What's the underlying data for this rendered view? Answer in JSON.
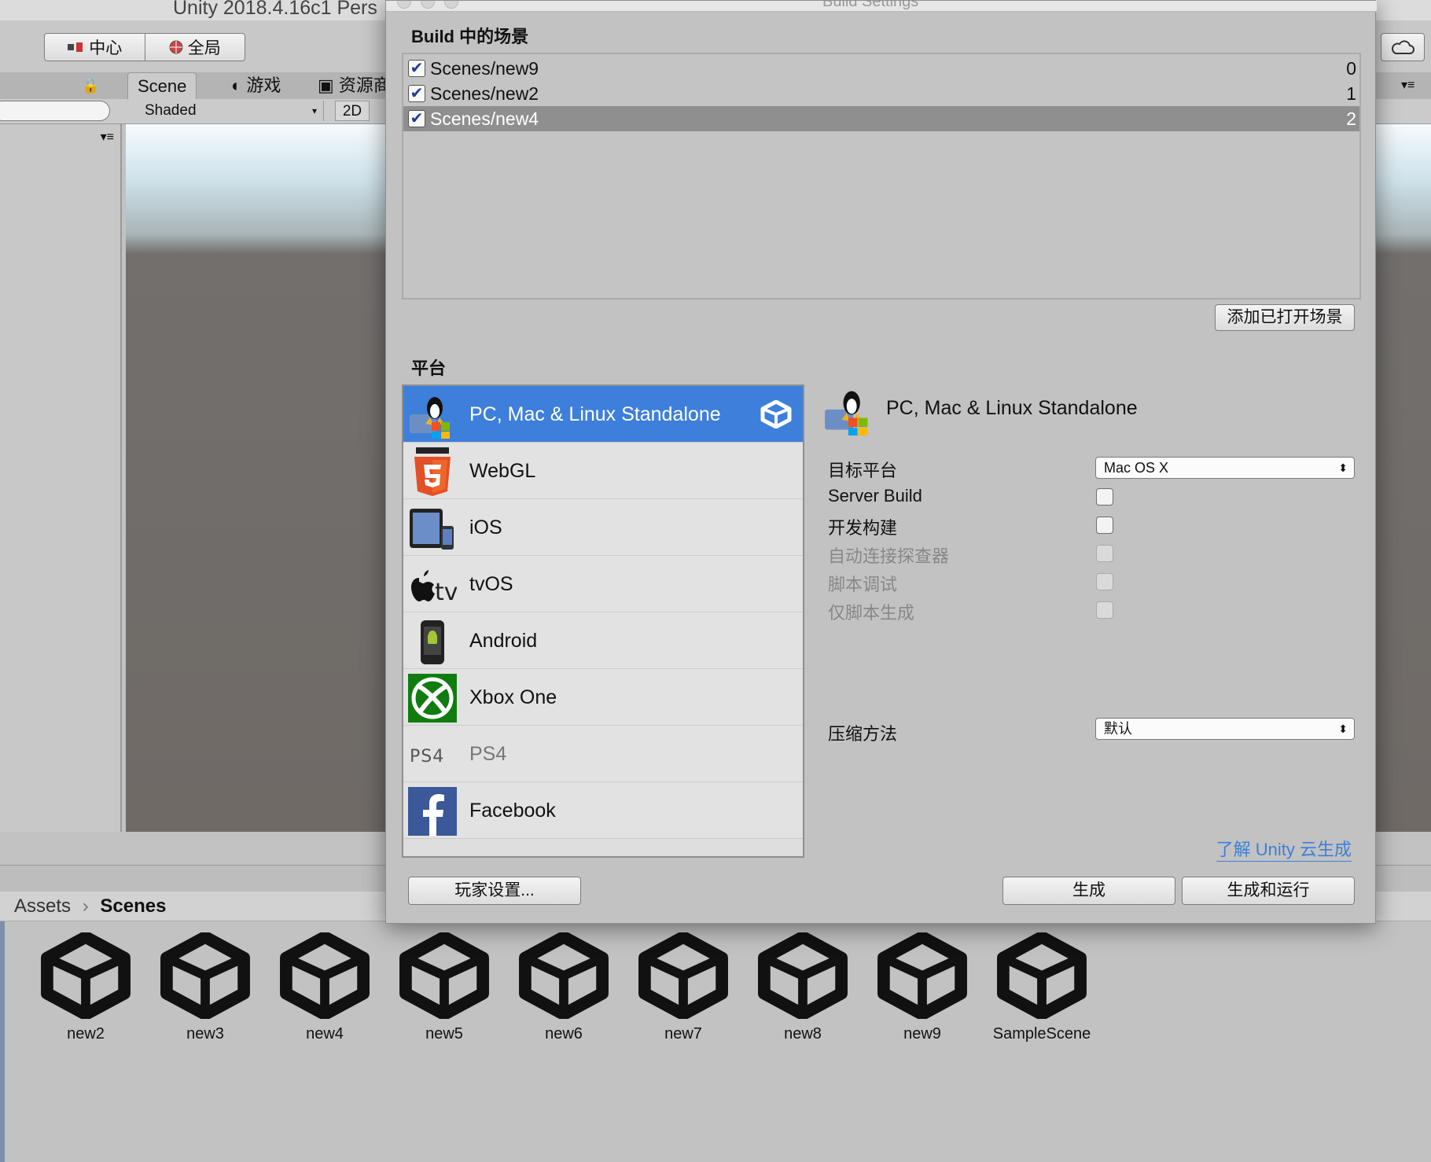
{
  "editor": {
    "window_title": "Unity 2018.4.16c1 Pers",
    "toolbar": {
      "pivot_label": "中心",
      "global_label": "全局"
    },
    "tabs": {
      "scene": "Scene",
      "game": "游戏",
      "asset_store": "资源商"
    },
    "scene_toolbar": {
      "shading_mode": "Shaded",
      "mode_2d": "2D"
    },
    "breadcrumb": {
      "root": "Assets",
      "current": "Scenes"
    },
    "assets": [
      "new2",
      "new3",
      "new4",
      "new5",
      "new6",
      "new7",
      "new8",
      "new9",
      "SampleScene"
    ]
  },
  "dialog": {
    "title": "Build Settings",
    "scenes_heading": "Build 中的场景",
    "scenes": [
      {
        "name": "Scenes/new9",
        "index": "0",
        "checked": true,
        "selected": false
      },
      {
        "name": "Scenes/new2",
        "index": "1",
        "checked": true,
        "selected": false
      },
      {
        "name": "Scenes/new4",
        "index": "2",
        "checked": true,
        "selected": true
      }
    ],
    "add_open_scenes": "添加已打开场景",
    "platform_heading": "平台",
    "platforms": [
      {
        "name": "PC, Mac & Linux Standalone",
        "icon": "standalone-icon",
        "selected": true
      },
      {
        "name": "WebGL",
        "icon": "html5-icon"
      },
      {
        "name": "iOS",
        "icon": "ipad-icon"
      },
      {
        "name": "tvOS",
        "icon": "apple-tv-icon"
      },
      {
        "name": "Android",
        "icon": "android-phone-icon"
      },
      {
        "name": "Xbox One",
        "icon": "xbox-icon"
      },
      {
        "name": "PS4",
        "icon": "ps4-icon",
        "dimmed": true
      },
      {
        "name": "Facebook",
        "icon": "facebook-icon"
      }
    ],
    "platform_settings": {
      "title": "PC, Mac & Linux Standalone",
      "target_platform_label": "目标平台",
      "target_platform_value": "Mac OS X",
      "server_build": "Server Build",
      "development_build": "开发构建",
      "autoconnect_profiler": "自动连接探查器",
      "script_debugging": "脚本调试",
      "scripts_only_build": "仅脚本生成",
      "compression_label": "压缩方法",
      "compression_value": "默认",
      "cloud_build_link": "了解 Unity 云生成"
    },
    "buttons": {
      "player_settings": "玩家设置...",
      "build": "生成",
      "build_and_run": "生成和运行"
    },
    "colors": {
      "selection_blue": "#3d7fdb",
      "selected_scene_gray": "#8f8f8f"
    }
  }
}
